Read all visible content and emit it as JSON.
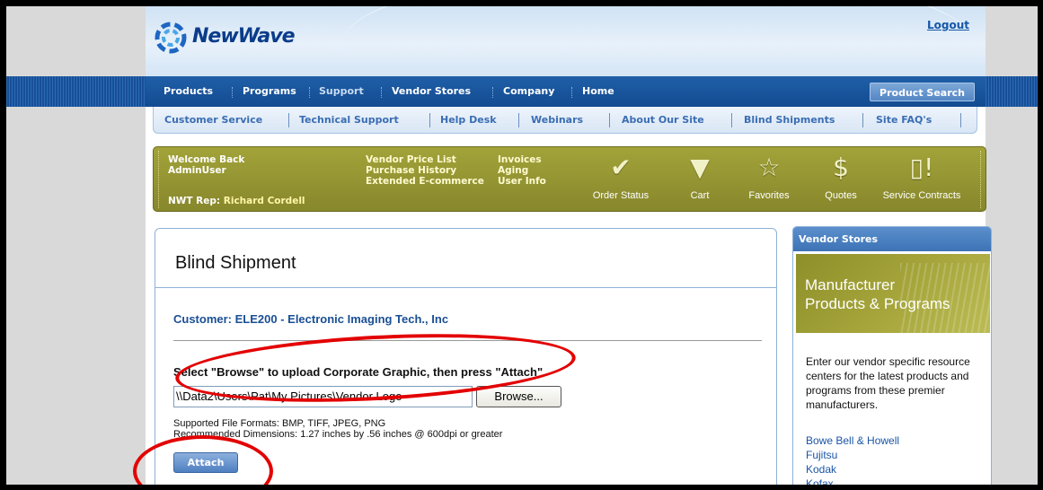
{
  "header": {
    "brand": "NewWave",
    "logout": "Logout"
  },
  "mainnav": {
    "items": [
      "Products",
      "Programs",
      "Support",
      "Vendor Stores",
      "Company",
      "Home"
    ],
    "product_search": "Product Search"
  },
  "subnav": {
    "items": [
      "Customer Service",
      "Technical Support",
      "Help Desk",
      "Webinars",
      "About Our Site",
      "Blind Shipments",
      "Site FAQ's"
    ]
  },
  "welcome": {
    "line1": "Welcome Back",
    "user": "AdminUser",
    "rep_label": "NWT Rep:",
    "rep_name": "Richard Cordell",
    "links_col1": [
      "Vendor Price List",
      "Purchase History",
      "Extended E-commerce"
    ],
    "links_col2": [
      "Invoices",
      "Aging",
      "User Info"
    ],
    "icons": [
      {
        "label": "Order Status",
        "icon": "checkmark-icon"
      },
      {
        "label": "Cart",
        "icon": "cart-icon"
      },
      {
        "label": "Favorites",
        "icon": "star-icon"
      },
      {
        "label": "Quotes",
        "icon": "dollar-icon"
      },
      {
        "label": "Service Contracts",
        "icon": "document-alert-icon"
      }
    ]
  },
  "content": {
    "title": "Blind Shipment",
    "customer": "Customer:  ELE200 - Electronic Imaging Tech., Inc",
    "instruction": "Select \"Browse\" to upload Corporate Graphic, then press \"Attach\"",
    "file_value": "\\\\Data2\\Users\\Pat\\My Pictures\\Vendor Logo",
    "browse_label": "Browse...",
    "formats": "Supported File Formats: BMP, TIFF, JPEG, PNG",
    "dimensions": "Recommended Dimensions: 1.27 inches by .56 inches @ 600dpi or greater",
    "attach_label": "Attach"
  },
  "vendor": {
    "header": "Vendor Stores",
    "banner_line1": "Manufacturer",
    "banner_line2": "Products & Programs",
    "description": "Enter our vendor specific resource centers for the latest products and programs from these premier manufacturers.",
    "links": [
      "Bowe Bell & Howell",
      "Fujitsu",
      "Kodak",
      "Kofax"
    ]
  },
  "colors": {
    "nav_blue": "#1f5fa8",
    "olive": "#9a9a35",
    "annotation_red": "#e30000"
  }
}
